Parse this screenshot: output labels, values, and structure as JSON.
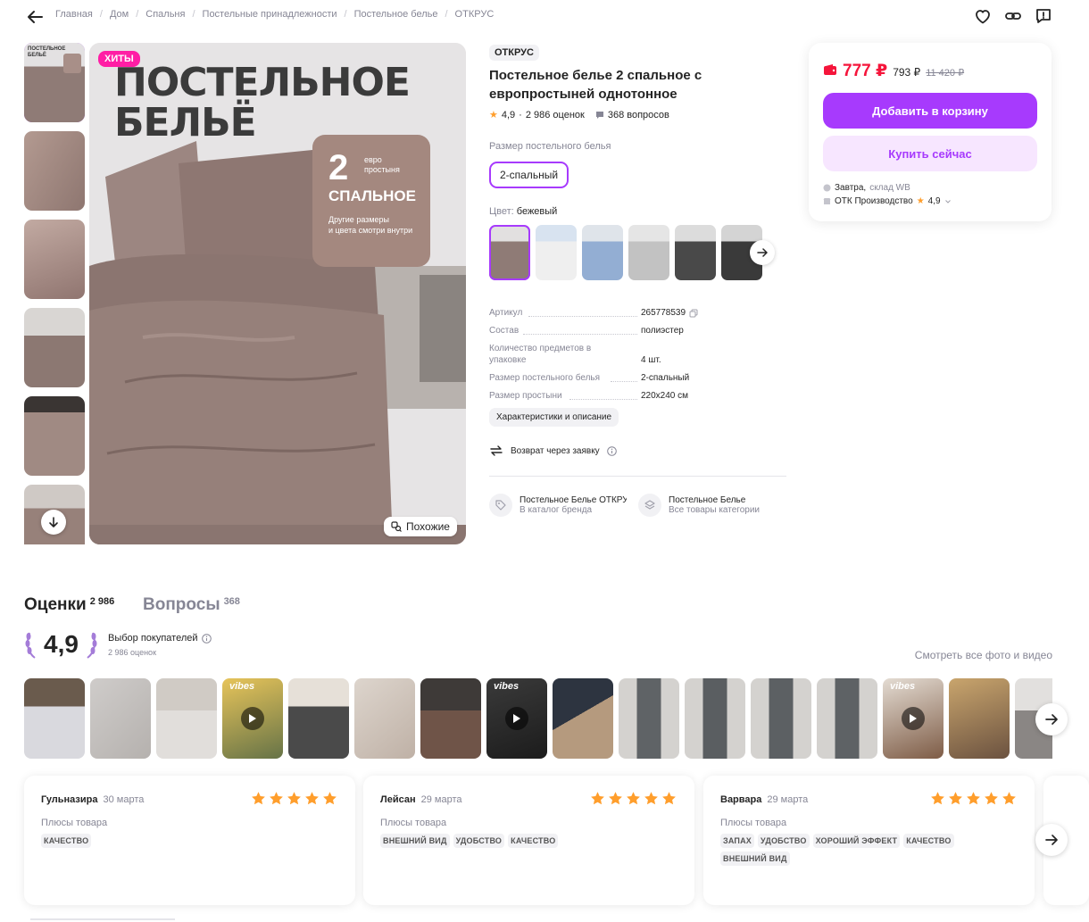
{
  "breadcrumbs": [
    "Главная",
    "Дом",
    "Спальня",
    "Постельные принадлежности",
    "Постельное белье",
    "ОТКРУС"
  ],
  "main_image": {
    "badge": "ХИТЫ",
    "headline_line1": "ПОСТЕЛЬНОЕ",
    "headline_line2": "БЕЛЬЁ",
    "card_number": "2",
    "card_badge_line1": "евро",
    "card_badge_line2": "простыня",
    "card_title": "СПАЛЬНОЕ",
    "card_sub_line1": "Другие размеры",
    "card_sub_line2": "и цвета смотри внутри",
    "similar_label": "Похожие"
  },
  "product": {
    "brand": "ОТКРУС",
    "title": "Постельное белье 2 спальное с европростыней однотонное",
    "rating": "4,9",
    "reviews_count": "2 986 оценок",
    "questions_count": "368 вопросов",
    "size_label": "Размер постельного белья",
    "size_value": "2-спальный",
    "color_label": "Цвет:",
    "color_value": "бежевый",
    "specs": [
      {
        "k": "Артикул",
        "v": "265778539"
      },
      {
        "k": "Состав",
        "v": "полиэстер"
      },
      {
        "k": "Количество предметов в упаковке",
        "v": "4 шт."
      },
      {
        "k": "Размер постельного белья",
        "v": "2-спальный"
      },
      {
        "k": "Размер простыни",
        "v": "220x240 см"
      }
    ],
    "desc_button": "Характеристики и описание",
    "return_text": "Возврат через заявку",
    "brand_link": {
      "title": "Постельное Белье ОТКРУС",
      "sub": "В каталог бренда"
    },
    "category_link": {
      "title": "Постельное Белье",
      "sub": "Все товары категории"
    }
  },
  "buy": {
    "price": "777 ₽",
    "price_old": "793 ₽",
    "price_strike": "11 420 ₽",
    "cart_button": "Добавить в корзину",
    "buy_button": "Купить сейчас",
    "delivery_day": "Завтра,",
    "delivery_from": "склад WB",
    "seller": "ОТК Производство",
    "seller_rating": "4,9"
  },
  "reviews": {
    "tab_reviews": "Оценки",
    "tab_reviews_count": "2 986",
    "tab_questions": "Вопросы",
    "tab_questions_count": "368",
    "rating": "4,9",
    "choice": "Выбор покупателей",
    "choice_sub": "2 986 оценок",
    "see_all": "Смотреть все фото и видео",
    "vibes_label": "vibes",
    "cards": [
      {
        "name": "Гульназира",
        "date": "30 марта",
        "pros_label": "Плюсы товара",
        "tags": [
          "КАЧЕСТВО"
        ]
      },
      {
        "name": "Лейсан",
        "date": "29 марта",
        "pros_label": "Плюсы товара",
        "tags": [
          "ВНЕШНИЙ ВИД",
          "УДОБСТВО",
          "КАЧЕСТВО"
        ]
      },
      {
        "name": "Варвара",
        "date": "29 марта",
        "pros_label": "Плюсы товара",
        "tags": [
          "ЗАПАХ",
          "УДОБСТВО",
          "ХОРОШИЙ ЭФФЕКТ",
          "КАЧЕСТВО",
          "ВНЕШНИЙ ВИД"
        ]
      }
    ]
  },
  "colors": {
    "accent": "#a73afd",
    "accent_light": "#f7e6ff",
    "price_red": "#f5153b",
    "badge_pink": "#ff1ea5",
    "star": "#ff9e2c",
    "linen_beige": "#8f7b76"
  }
}
